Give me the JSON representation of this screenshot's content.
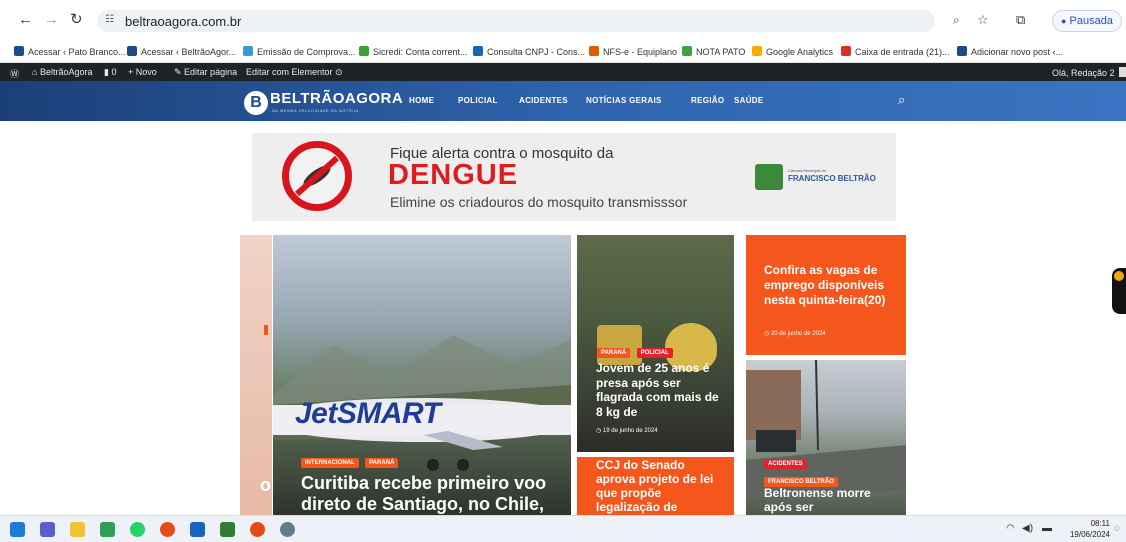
{
  "browser": {
    "url": "beltraoagora.com.br",
    "profile_label": "Pausada",
    "bookmarks": [
      {
        "label": "Acessar ‹ Pato Branco...",
        "color": "#1a4d8f"
      },
      {
        "label": "Acessar ‹ BeltrãoAgor...",
        "color": "#1f4a86"
      },
      {
        "label": "Emissão de Comprova...",
        "color": "#3a9ad9"
      },
      {
        "label": "Sicredi: Conta corrent...",
        "color": "#3ba335"
      },
      {
        "label": "Consulta CNPJ - Cons...",
        "color": "#1565c0"
      },
      {
        "label": "NFS-e - Equiplano",
        "color": "#e05a00"
      },
      {
        "label": "NOTA PATO",
        "color": "#43a047"
      },
      {
        "label": "Google Analytics",
        "color": "#f9ab00"
      },
      {
        "label": "Caixa de entrada (21)...",
        "color": "#d93025"
      },
      {
        "label": "Adicionar novo post ‹...",
        "color": "#1f4a86"
      }
    ]
  },
  "wp_admin_bar": {
    "site_name": "BeltrãoAgora",
    "comments_count": "0",
    "new_label": "Novo",
    "edit_page_label": "Editar página",
    "elementor_label": "Editar com Elementor",
    "greeting": "Olá, Redação 2"
  },
  "site_nav": {
    "logo_text": "BELTRÃOAGORA",
    "logo_tagline": "NA MESMA VELOCIDADE DA NOTÍCIA",
    "menu": [
      "HOME",
      "POLICIAL",
      "ACIDENTES",
      "NOTÍCIAS GERAIS",
      "REGIÃO",
      "SAÚDE"
    ]
  },
  "banner": {
    "line1": "Fique alerta contra o mosquito da",
    "highlight": "DENGUE",
    "line3": "Elimine os criadouros do mosquito transmisssor",
    "org_small": "Câmara Municipal de",
    "org": "FRANCISCO BELTRÃO"
  },
  "articles": {
    "main": {
      "tags": [
        "INTERNACIONAL",
        "PARANÁ"
      ],
      "title": "Curitiba recebe primeiro voo direto de Santiago, no Chile,",
      "side_letter": "o",
      "plane_text": "JetSMART"
    },
    "middle_top": {
      "tags": [
        "PARANÁ",
        "POLICIAL"
      ],
      "title": "Jovem de 25 anos é presa após ser flagrada com mais de 8 kg de",
      "date": "19 de junho de 2024"
    },
    "middle_bottom": {
      "title": "CCJ do Senado aprova projeto de lei que propõe legalização de"
    },
    "right_top": {
      "title": "Confira as vagas de emprego disponíveis nesta quinta-feira(20)",
      "date": "20 de junho de 2024"
    },
    "right_bottom": {
      "tags": [
        "ACIDENTES",
        "FRANCISCO BELTRÃO"
      ],
      "title": "Beltronense morre após ser"
    }
  },
  "taskbar": {
    "time": "08:11",
    "date": "19/06/2024"
  },
  "colors": {
    "accent_orange": "#f4561c",
    "nav_blue": "#2f63ad",
    "tag_red": "#e2232a",
    "wp_bar": "#1d2327"
  }
}
